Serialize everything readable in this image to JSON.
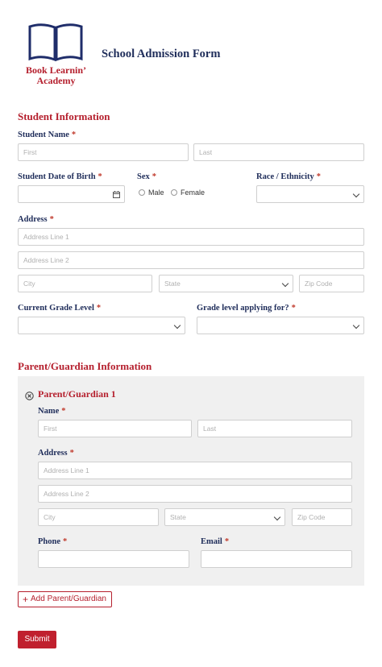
{
  "logo": {
    "line1": "Book Learnin’",
    "line2": "Academy"
  },
  "form_title": "School Admission Form",
  "student": {
    "section_title": "Student Information",
    "name_label": "Student Name",
    "first_placeholder": "First",
    "last_placeholder": "Last",
    "dob_label": "Student Date of Birth",
    "sex_label": "Sex",
    "sex_options": [
      "Male",
      "Female"
    ],
    "race_label": "Race / Ethnicity",
    "address_label": "Address",
    "address1_placeholder": "Address Line 1",
    "address2_placeholder": "Address Line 2",
    "city_placeholder": "City",
    "state_placeholder": "State",
    "zip_placeholder": "Zip Code",
    "current_grade_label": "Current Grade Level",
    "applying_grade_label": "Grade level applying for?"
  },
  "guardian": {
    "section_title": "Parent/Guardian Information",
    "card_title": "Parent/Guardian 1",
    "name_label": "Name",
    "first_placeholder": "First",
    "last_placeholder": "Last",
    "address_label": "Address",
    "address1_placeholder": "Address Line 1",
    "address2_placeholder": "Address Line 2",
    "city_placeholder": "City",
    "state_placeholder": "State",
    "zip_placeholder": "Zip Code",
    "phone_label": "Phone",
    "email_label": "Email"
  },
  "required_marker": "*",
  "add_guardian_label": "Add Parent/Guardian",
  "submit_label": "Submit"
}
